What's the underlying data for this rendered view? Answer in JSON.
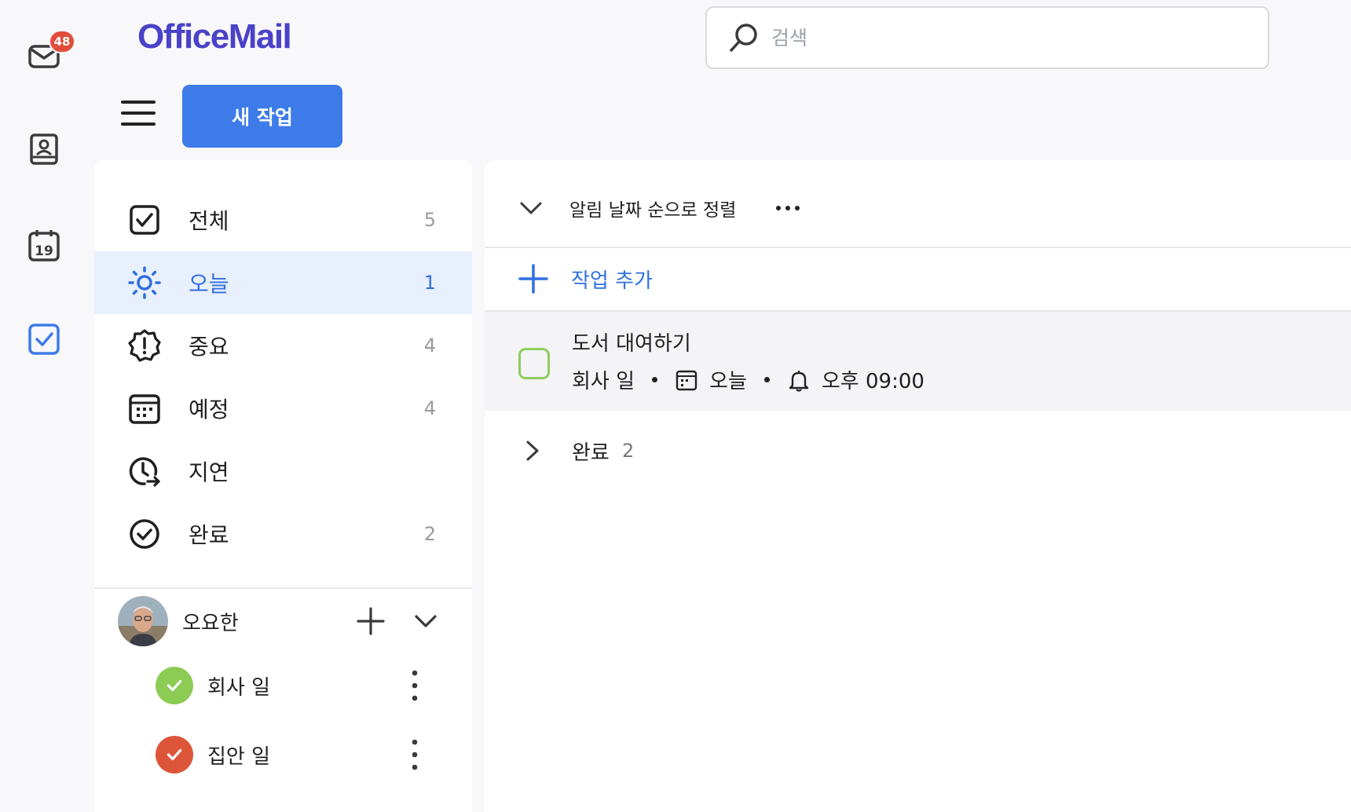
{
  "app": {
    "logo": "OfficeMail"
  },
  "rail": {
    "mail_badge": "48",
    "calendar_day": "19"
  },
  "search": {
    "placeholder": "검색"
  },
  "toolbar": {
    "new_task_label": "새 작업"
  },
  "nav": {
    "items": [
      {
        "label": "전체",
        "count": "5"
      },
      {
        "label": "오늘",
        "count": "1"
      },
      {
        "label": "중요",
        "count": "4"
      },
      {
        "label": "예정",
        "count": "4"
      },
      {
        "label": "지연",
        "count": ""
      },
      {
        "label": "완료",
        "count": "2"
      }
    ],
    "active_index": 1
  },
  "account": {
    "name": "오요한",
    "lists": [
      {
        "label": "회사 일",
        "color": "#8ccc55"
      },
      {
        "label": "집안 일",
        "color": "#dd5539"
      }
    ]
  },
  "main": {
    "sort_label": "알림 날짜 순으로 정렬",
    "add_task_label": "작업 추가",
    "tasks": [
      {
        "title": "도서 대여하기",
        "list": "회사 일",
        "due": "오늘",
        "reminder": "오후 09:00"
      }
    ],
    "completed": {
      "label": "완료",
      "count": "2"
    }
  },
  "colors": {
    "accent": "#3d7be8",
    "logo": "#4a42c8",
    "badge": "#e24c3b",
    "active_bg": "#e8effd"
  }
}
